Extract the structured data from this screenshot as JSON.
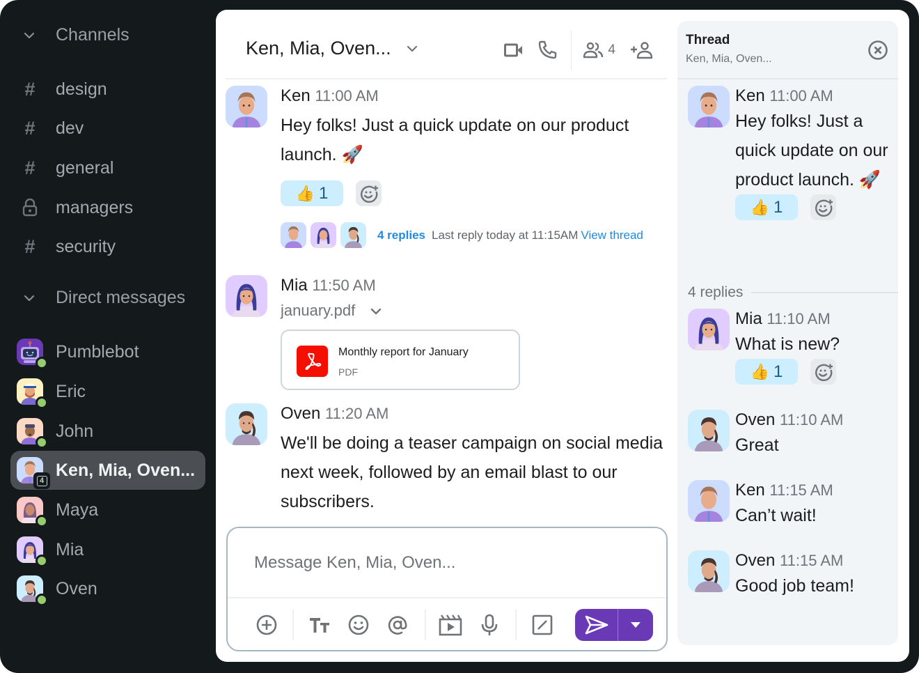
{
  "sidebar": {
    "channels_header": "Channels",
    "channels": [
      {
        "name": "design",
        "icon": "hash-icon"
      },
      {
        "name": "dev",
        "icon": "hash-icon"
      },
      {
        "name": "general",
        "icon": "hash-icon"
      },
      {
        "name": "managers",
        "icon": "lock-icon"
      },
      {
        "name": "security",
        "icon": "hash-icon"
      }
    ],
    "dm_header": "Direct messages",
    "dms": [
      {
        "name": "Pumblebot",
        "avatar": "bot",
        "status": "online",
        "active": false
      },
      {
        "name": "Eric",
        "avatar": "eric",
        "status": "online",
        "active": false
      },
      {
        "name": "John",
        "avatar": "john",
        "status": "online",
        "active": false
      },
      {
        "name": "Ken, Mia, Oven...",
        "avatar": "ken",
        "group_count": "4",
        "active": true
      },
      {
        "name": "Maya",
        "avatar": "maya",
        "status": "online",
        "active": false
      },
      {
        "name": "Mia",
        "avatar": "mia",
        "status": "online",
        "active": false
      },
      {
        "name": "Oven",
        "avatar": "oven",
        "status": "online",
        "active": false
      }
    ]
  },
  "header": {
    "title": "Ken, Mia, Oven...",
    "member_count": "4",
    "icons": [
      "video-icon",
      "phone-icon",
      "members-icon",
      "add-member-icon"
    ]
  },
  "messages": [
    {
      "author": "Ken",
      "time": "11:00 AM",
      "text": "Hey folks! Just a quick update on our product launch. 🚀",
      "reaction": {
        "emoji": "👍",
        "count": "1"
      },
      "thread": {
        "replies": "4 replies",
        "last": "Last reply today at 11:15AM",
        "view": "View thread"
      }
    },
    {
      "author": "Mia",
      "time": "11:50 AM",
      "file_name": "january.pdf",
      "file": {
        "title": "Monthly report for January",
        "type": "PDF"
      }
    },
    {
      "author": "Oven",
      "time": "11:20 AM",
      "text": "We'll be doing a teaser campaign on social media next week, followed by an email blast to our subscribers."
    }
  ],
  "composer": {
    "placeholder": "Message Ken, Mia, Oven...",
    "tools": [
      "add-icon",
      "text-format-icon",
      "emoji-icon",
      "mention-icon",
      "video-clip-icon",
      "microphone-icon",
      "slash-command-icon"
    ]
  },
  "thread": {
    "title": "Thread",
    "subtitle": "Ken, Mia, Oven...",
    "parent": {
      "author": "Ken",
      "time": "11:00 AM",
      "text": "Hey folks! Just a quick update on our product launch. 🚀",
      "reaction": {
        "emoji": "👍",
        "count": "1"
      }
    },
    "replies_label": "4 replies",
    "replies": [
      {
        "author": "Mia",
        "time": "11:10 AM",
        "text": "What is new?",
        "reaction": {
          "emoji": "👍",
          "count": "1"
        }
      },
      {
        "author": "Oven",
        "time": "11:10 AM",
        "text": "Great"
      },
      {
        "author": "Ken",
        "time": "11:15 AM",
        "text": "Can’t wait!"
      },
      {
        "author": "Oven",
        "time": "11:15 AM",
        "text": "Good job team!"
      }
    ]
  },
  "colors": {
    "sidebar_bg": "#14191c",
    "active_dm_bg": "#4b4f53",
    "online": "#95cc6e",
    "accent": "#6a3ab6",
    "link": "#1f8be6",
    "reaction_bg": "#cdeeff",
    "thread_bg": "#f2f5f8",
    "pdf_red": "#f40f02"
  }
}
